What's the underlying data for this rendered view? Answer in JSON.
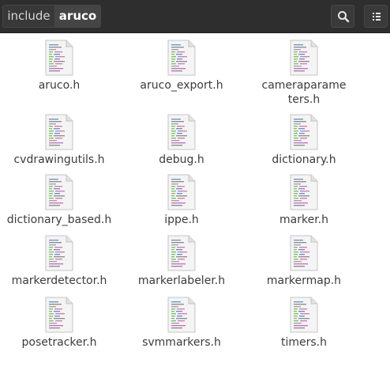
{
  "header": {
    "breadcrumbs": [
      {
        "label": "include"
      },
      {
        "label": "aruco"
      }
    ],
    "search_icon": "search-icon",
    "menu_icon": "view-options-icon",
    "colors": {
      "header_bg": "#2e2e2e",
      "accent_text": "#ffffff"
    }
  },
  "files": [
    {
      "label": "aruco.h"
    },
    {
      "label": "aruco_export.h"
    },
    {
      "label": "cameraparameters.h"
    },
    {
      "label": "cvdrawingutils.h"
    },
    {
      "label": "debug.h"
    },
    {
      "label": "dictionary.h"
    },
    {
      "label": "dictionary_based.h"
    },
    {
      "label": "ippe.h"
    },
    {
      "label": "marker.h"
    },
    {
      "label": "markerdetector.h"
    },
    {
      "label": "markerlabeler.h"
    },
    {
      "label": "markermap.h"
    },
    {
      "label": "posetracker.h"
    },
    {
      "label": "svmmarkers.h"
    },
    {
      "label": "timers.h"
    }
  ]
}
